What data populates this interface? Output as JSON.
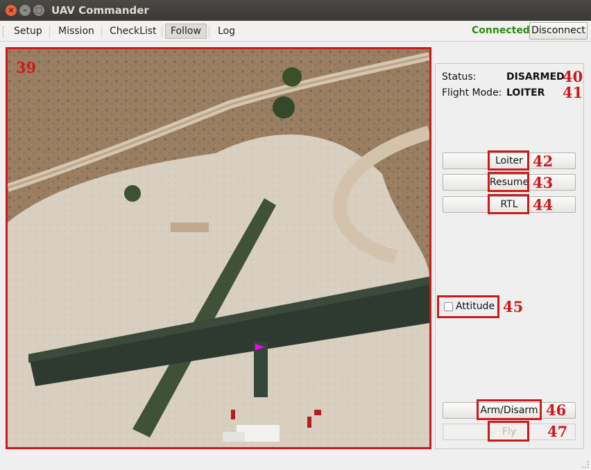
{
  "window": {
    "title": "UAV Commander"
  },
  "toolbar": {
    "tabs": [
      {
        "label": "Setup",
        "active": false
      },
      {
        "label": "Mission",
        "active": false
      },
      {
        "label": "CheckList",
        "active": false
      },
      {
        "label": "Follow",
        "active": true
      },
      {
        "label": "Log",
        "active": false
      }
    ],
    "connection_status": "Connected",
    "disconnect_label": "Disconnect"
  },
  "map": {
    "annotation": "39",
    "marker_color": "#ff00ff"
  },
  "panel": {
    "status_label": "Status:",
    "status_value": "DISARMED",
    "status_annotation": "40",
    "mode_label": "Flight Mode:",
    "mode_value": "LOITER",
    "mode_annotation": "41",
    "buttons": [
      {
        "label": "Loiter",
        "annotation": "42",
        "enabled": true
      },
      {
        "label": "Resume",
        "annotation": "43",
        "enabled": true
      },
      {
        "label": "RTL",
        "annotation": "44",
        "enabled": true
      }
    ],
    "attitude": {
      "label": "Attitude",
      "checked": false,
      "annotation": "45"
    },
    "arm_button": {
      "label": "Arm/Disarm",
      "annotation": "46",
      "enabled": true
    },
    "fly_button": {
      "label": "Fly",
      "annotation": "47",
      "enabled": false
    }
  },
  "colors": {
    "annotation_red": "#cc1a1a",
    "connected_green": "#2a8a14"
  }
}
